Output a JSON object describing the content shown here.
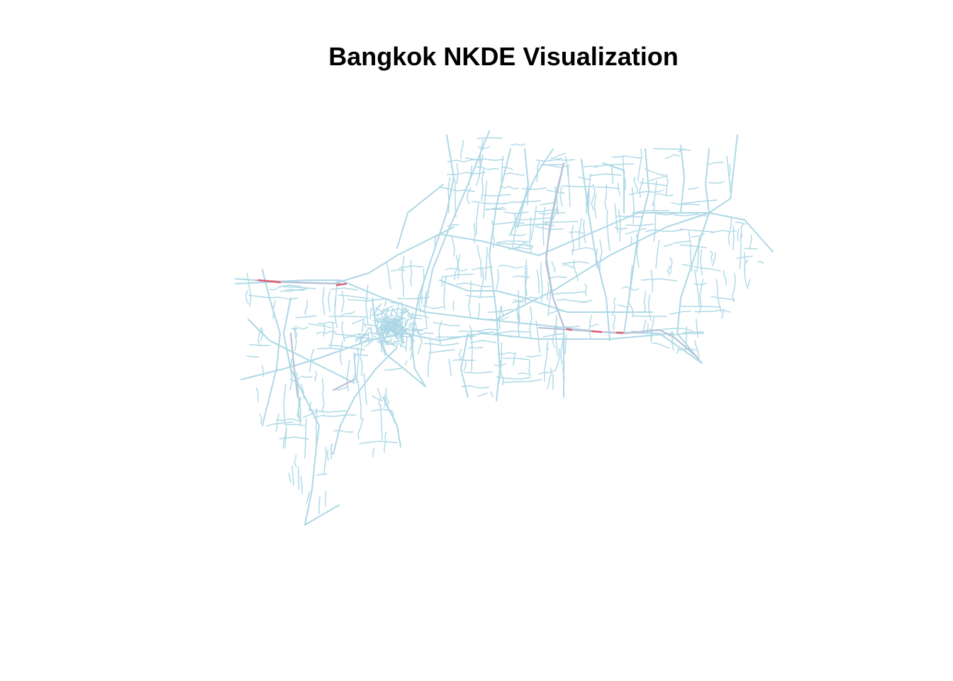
{
  "plot": {
    "title": "Bangkok NKDE Visualization"
  },
  "map": {
    "region": "Bangkok",
    "layer": "road network",
    "network_color": "#add8e6",
    "medium_density_color": "#b9c2d6",
    "high_density_color": "#e05a6e",
    "background_color": "#ffffff"
  }
}
